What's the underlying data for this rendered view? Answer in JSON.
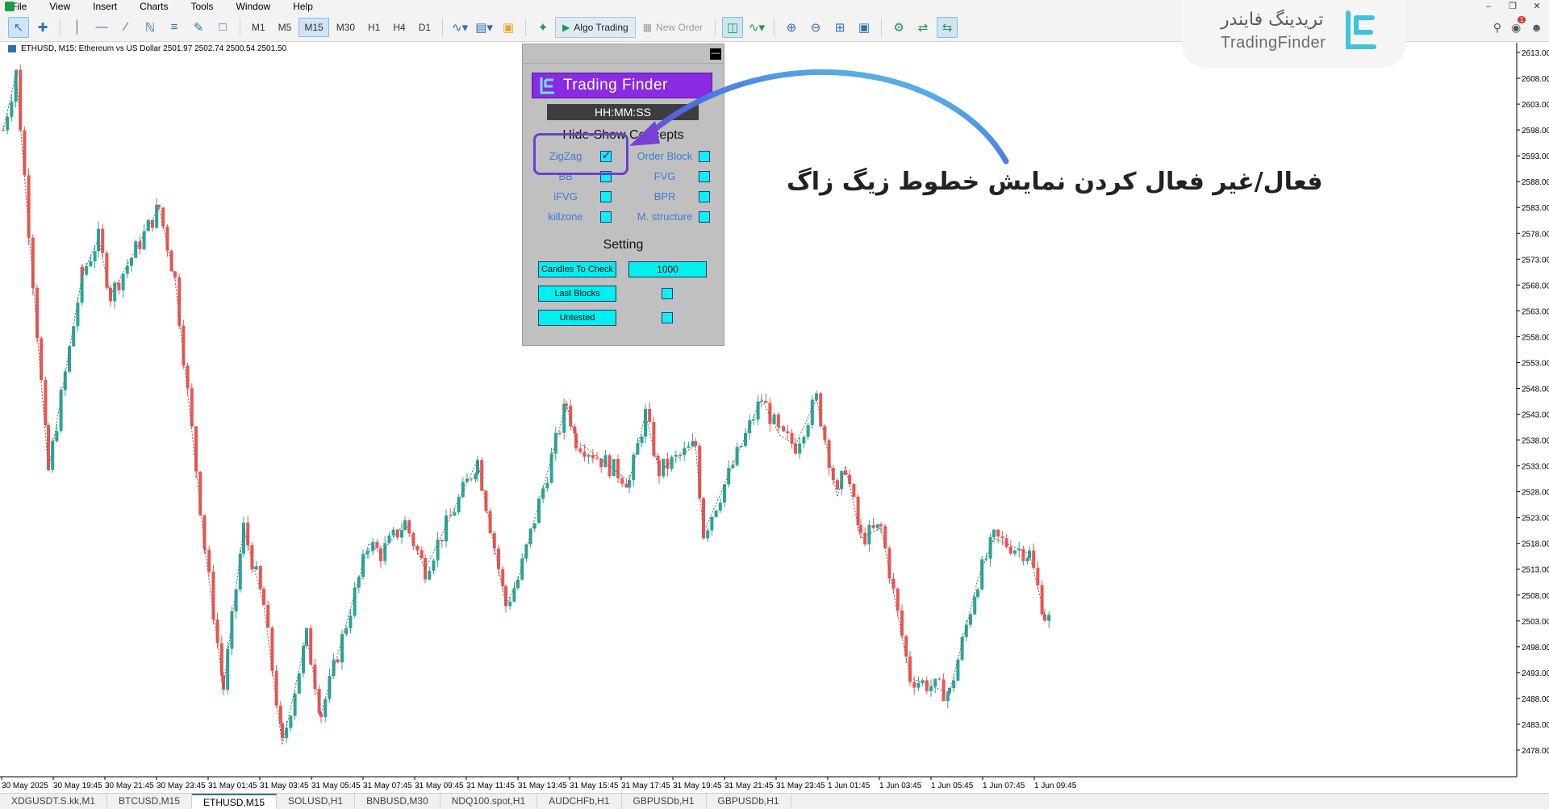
{
  "menu": [
    "File",
    "View",
    "Insert",
    "Charts",
    "Tools",
    "Window",
    "Help"
  ],
  "toolbar": {
    "timeframes": [
      "M1",
      "M5",
      "M15",
      "M30",
      "H1",
      "H4",
      "D1"
    ],
    "active_timeframe": "M15",
    "algo_trading": "Algo Trading",
    "new_order": "New Order"
  },
  "logo": {
    "persian": "تریدینگ فایندر",
    "english": "TradingFinder"
  },
  "notification_count": "1",
  "chart": {
    "title": "ETHUSD, M15:  Ethereum vs US Dollar  2501.97 2502.74 2500.54 2501.50",
    "price_labels": [
      "2613.00",
      "2608.00",
      "2603.00",
      "2598.00",
      "2593.00",
      "2588.00",
      "2583.00",
      "2578.00",
      "2573.00",
      "2568.00",
      "2563.00",
      "2558.00",
      "2553.00",
      "2548.00",
      "2543.00",
      "2538.00",
      "2533.00",
      "2528.00",
      "2523.00",
      "2518.00",
      "2513.00",
      "2508.00",
      "2503.00",
      "2498.00",
      "2493.00",
      "2488.00",
      "2483.00",
      "2478.00"
    ],
    "time_labels": [
      "30 May 2025",
      "30 May 19:45",
      "30 May 21:45",
      "30 May 23:45",
      "31 May 01:45",
      "31 May 03:45",
      "31 May 05:45",
      "31 May 07:45",
      "31 May 09:45",
      "31 May 11:45",
      "31 May 13:45",
      "31 May 15:45",
      "31 May 17:45",
      "31 May 19:45",
      "31 May 21:45",
      "31 May 23:45",
      "1 Jun 01:45",
      "1 Jun 03:45",
      "1 Jun 05:45",
      "1 Jun 07:45",
      "1 Jun 09:45"
    ],
    "colors": {
      "bull": "#26a69a",
      "bear": "#ef5350",
      "zigzag": "#666666"
    }
  },
  "panel": {
    "brand": "Trading Finder",
    "clock": "HH:MM:SS",
    "concepts_heading": "Hide-Show Concepts",
    "concepts": [
      {
        "label": "ZigZag",
        "checked": true
      },
      {
        "label": "Order Block",
        "checked": false
      },
      {
        "label": "BB",
        "checked": false
      },
      {
        "label": "FVG",
        "checked": false
      },
      {
        "label": "iFVG",
        "checked": false
      },
      {
        "label": "BPR",
        "checked": false
      },
      {
        "label": "killzone",
        "checked": false
      },
      {
        "label": "M. structure",
        "checked": false
      }
    ],
    "setting_heading": "Setting",
    "candles_to_check_label": "Candles To Check",
    "candles_to_check_value": "1000",
    "last_blocks_label": "Last Blocks",
    "untested_label": "Untested"
  },
  "annotation": {
    "text": "فعال/غیر فعال کردن نمایش خطوط زیگ زاگ"
  },
  "tabs": [
    "XDGUSDT.S.kk,M1",
    "BTCUSD,M15",
    "ETHUSD,M15",
    "SOLUSD,H1",
    "BNBUSD,M30",
    "NDQ100.spot,H1",
    "AUDCHFb,H1",
    "GBPUSDb,H1",
    "GBPUSDb,H1"
  ],
  "active_tab": "ETHUSD,M15"
}
